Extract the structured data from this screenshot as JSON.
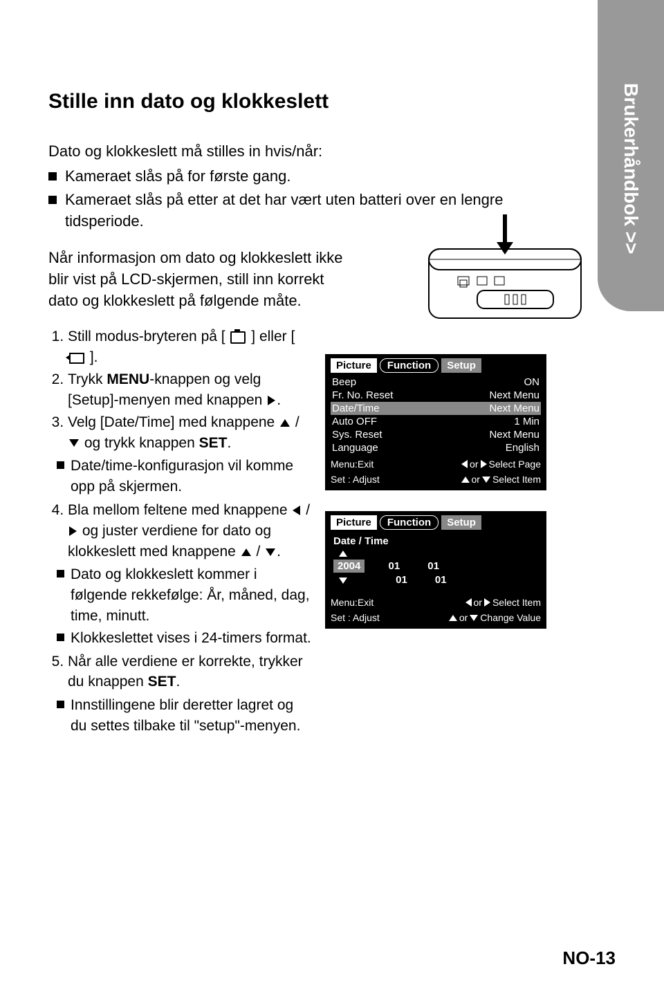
{
  "sidebar_label": "Brukerhåndbok >>",
  "title": "Stille inn dato og klokkeslett",
  "intro_line": "Dato og klokkeslett må stilles in hvis/når:",
  "intro_bullets": [
    "Kameraet slås på for første gang.",
    "Kameraet slås på etter at det har vært uten batteri over en lengre tidsperiode."
  ],
  "mid_para": "Når informasjon om dato og klokkeslett ikke blir vist på LCD-skjermen, still inn korrekt dato og klokkeslett på følgende måte.",
  "steps": {
    "s1_pre": "Still modus-bryteren på [ ",
    "s1_mid": " ] eller [ ",
    "s1_post": " ].",
    "s2_pre": "Trykk ",
    "s2_menu": "MENU",
    "s2_post": "-knappen og velg [Setup]-menyen med knappen ",
    "s2_end": ".",
    "s3_pre": "Velg [Date/Time] med knappene ",
    "s3_mid": " / ",
    "s3_post": " og trykk knappen ",
    "s3_set": "SET",
    "s3_end": ".",
    "s3_sub": "Date/time-konfigurasjon vil komme opp på skjermen.",
    "s4_pre": "Bla mellom feltene med knappene ",
    "s4_mid1": " / ",
    "s4_mid2": " og juster verdiene for dato og klokkeslett med knappene ",
    "s4_mid3": " / ",
    "s4_end": ".",
    "s4_sub1": "Dato og klokkeslett kommer i følgende rekkefølge: År, måned, dag, time, minutt.",
    "s4_sub2": "Klokkeslettet vises i 24-timers format.",
    "s5_pre": "Når alle verdiene er korrekte, trykker du knappen ",
    "s5_set": "SET",
    "s5_end": ".",
    "s5_sub": "Innstillingene blir deretter lagret og du settes tilbake til \"setup\"-menyen."
  },
  "screen1": {
    "tabs": {
      "picture": "Picture",
      "function": "Function",
      "setup": "Setup"
    },
    "rows": [
      {
        "l": "Beep",
        "r": "ON"
      },
      {
        "l": "Fr. No. Reset",
        "r": "Next Menu"
      },
      {
        "l": "Date/Time",
        "r": "Next Menu",
        "sel": true
      },
      {
        "l": "Auto OFF",
        "r": "1 Min"
      },
      {
        "l": "Sys. Reset",
        "r": "Next Menu"
      },
      {
        "l": "Language",
        "r": "English"
      }
    ],
    "hint_menu": "Menu:Exit",
    "hint_set": "Set : Adjust",
    "hint_or": "or",
    "hint_page": "Select Page",
    "hint_item": "Select Item"
  },
  "screen2": {
    "tabs": {
      "picture": "Picture",
      "function": "Function",
      "setup": "Setup"
    },
    "title": "Date / Time",
    "year": "2004",
    "vals_row1": [
      "01",
      "01"
    ],
    "vals_row2": [
      "01",
      "01"
    ],
    "hint_menu": "Menu:Exit",
    "hint_set": "Set : Adjust",
    "hint_or": "or",
    "hint_sel": "Select Item",
    "hint_chg": "Change Value"
  },
  "page_number": "NO-13"
}
